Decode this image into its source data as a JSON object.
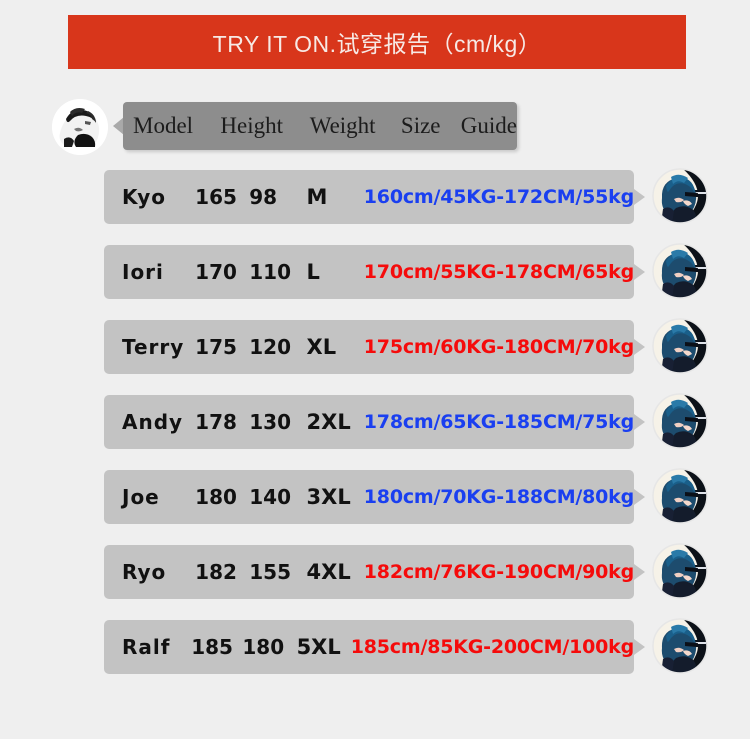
{
  "banner": {
    "text": "TRY IT ON.试穿报告（cm/kg）",
    "bg_color": "#d8361b",
    "text_color": "#f7e9e5"
  },
  "table": {
    "header": {
      "columns": [
        "Model",
        "Height",
        "Weight",
        "Size",
        "Guide"
      ],
      "bg_color": "#8d8d8d"
    },
    "row_bg_color": "#c3c3c3",
    "guide_colors": {
      "blue": "#1a3ff0",
      "red": "#f50b0b"
    },
    "rows": [
      {
        "model": "Kyo",
        "height": "165",
        "weight": "98",
        "size": "M",
        "guide": "160cm/45KG-172CM/55kg",
        "guide_color": "blue",
        "avatar": "anime-avatar-icon"
      },
      {
        "model": "Iori",
        "height": "170",
        "weight": "110",
        "size": "L",
        "guide": "170cm/55KG-178CM/65kg",
        "guide_color": "red",
        "avatar": "anime-avatar-icon"
      },
      {
        "model": "Terry",
        "height": "175",
        "weight": "120",
        "size": "XL",
        "guide": "175cm/60KG-180CM/70kg",
        "guide_color": "red",
        "avatar": "anime-avatar-icon"
      },
      {
        "model": "Andy",
        "height": "178",
        "weight": "130",
        "size": "2XL",
        "guide": "178cm/65KG-185CM/75kg",
        "guide_color": "blue",
        "avatar": "anime-avatar-icon"
      },
      {
        "model": "Joe",
        "height": "180",
        "weight": "140",
        "size": "3XL",
        "guide": "180cm/70KG-188CM/80kg",
        "guide_color": "blue",
        "avatar": "anime-avatar-icon"
      },
      {
        "model": "Ryo",
        "height": "182",
        "weight": "155",
        "size": "4XL",
        "guide": "182cm/76KG-190CM/90kg",
        "guide_color": "red",
        "avatar": "anime-avatar-icon"
      },
      {
        "model": "Ralf",
        "height": "185",
        "weight": "180",
        "size": "5XL",
        "guide": "185cm/85KG-200CM/100kg",
        "guide_color": "red",
        "avatar": "anime-avatar-icon"
      }
    ]
  },
  "page": {
    "bg_color": "#efefef"
  }
}
